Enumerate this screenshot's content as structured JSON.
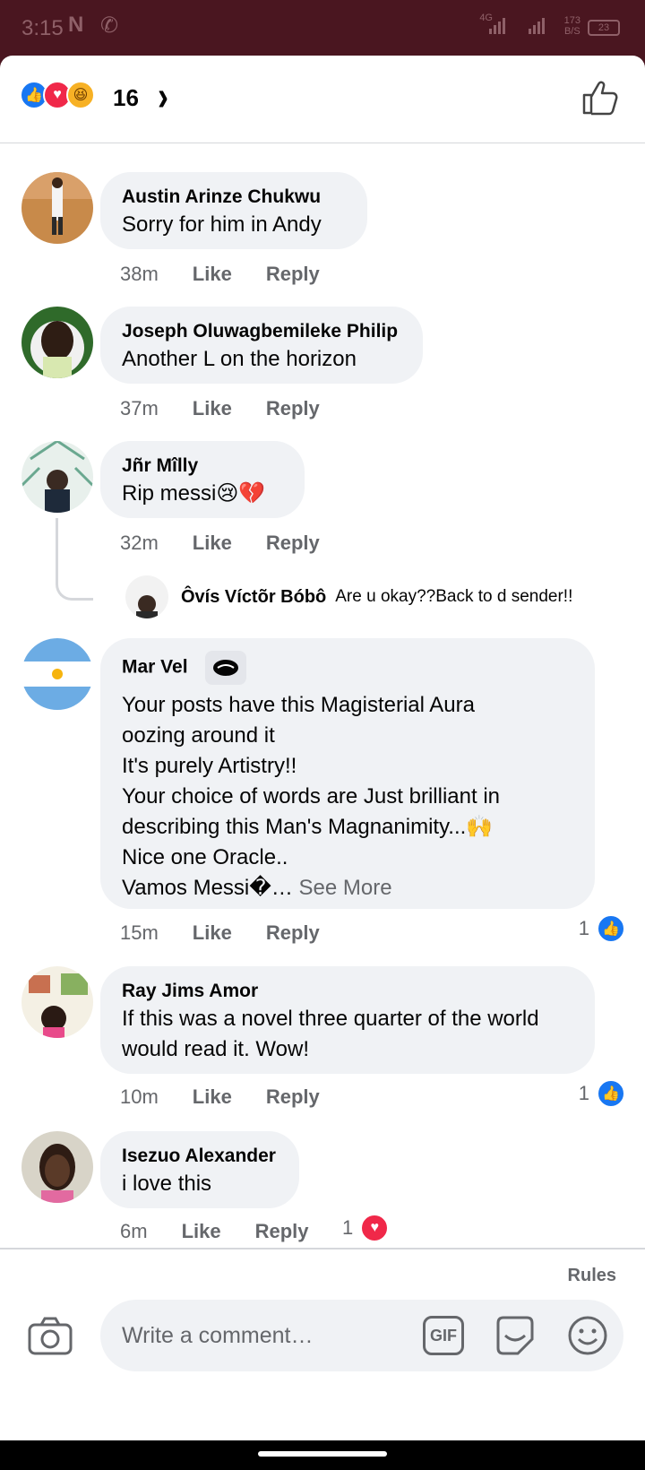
{
  "status_bar": {
    "time": "3:15",
    "network": "4G",
    "speed_top": "173",
    "speed_unit": "B/S",
    "battery": "23"
  },
  "reactions": {
    "count": "16",
    "icons": [
      "like-icon",
      "love-icon",
      "haha-icon"
    ]
  },
  "comments": [
    {
      "name": "Austin Arinze Chukwu",
      "text": "Sorry for him in Andy",
      "time": "38m",
      "like": "Like",
      "reply": "Reply"
    },
    {
      "name": "Joseph Oluwagbemileke Philip",
      "text": "Another L on the horizon",
      "time": "37m",
      "like": "Like",
      "reply": "Reply"
    },
    {
      "name": "Jñr Mîlly",
      "text": "Rip messi😢💔",
      "time": "32m",
      "like": "Like",
      "reply": "Reply",
      "reply_preview": {
        "name": "Ôvís Víctõr Bóbô",
        "text": "Are u okay??Back to d sender!!"
      }
    },
    {
      "name": "Mar Vel",
      "text": " Your posts have this Magisterial Aura\noozing around it\nIt's purely Artistry!!\nYour choice of words are Just brilliant in\ndescribing this Man's Magnanimity...🙌\nNice one Oracle..\nVamos Messi�…",
      "see_more": "See More",
      "time": "15m",
      "like": "Like",
      "reply": "Reply",
      "reactions": "1"
    },
    {
      "name": "Ray Jims Amor",
      "text": "If this was a novel three quarter of the world\nwould read it. Wow!",
      "time": "10m",
      "like": "Like",
      "reply": "Reply",
      "reactions": "1"
    },
    {
      "name": "Isezuo Alexander",
      "text": "i love this",
      "time": "6m",
      "like": "Like",
      "reply": "Reply",
      "reactions": "1"
    }
  ],
  "footer": {
    "rules": "Rules",
    "placeholder": "Write a comment…",
    "gif": "GIF"
  },
  "colors": {
    "accent": "#1877f2",
    "love": "#f02849",
    "bubble": "#f0f2f5",
    "statusbar": "#4a1620"
  }
}
